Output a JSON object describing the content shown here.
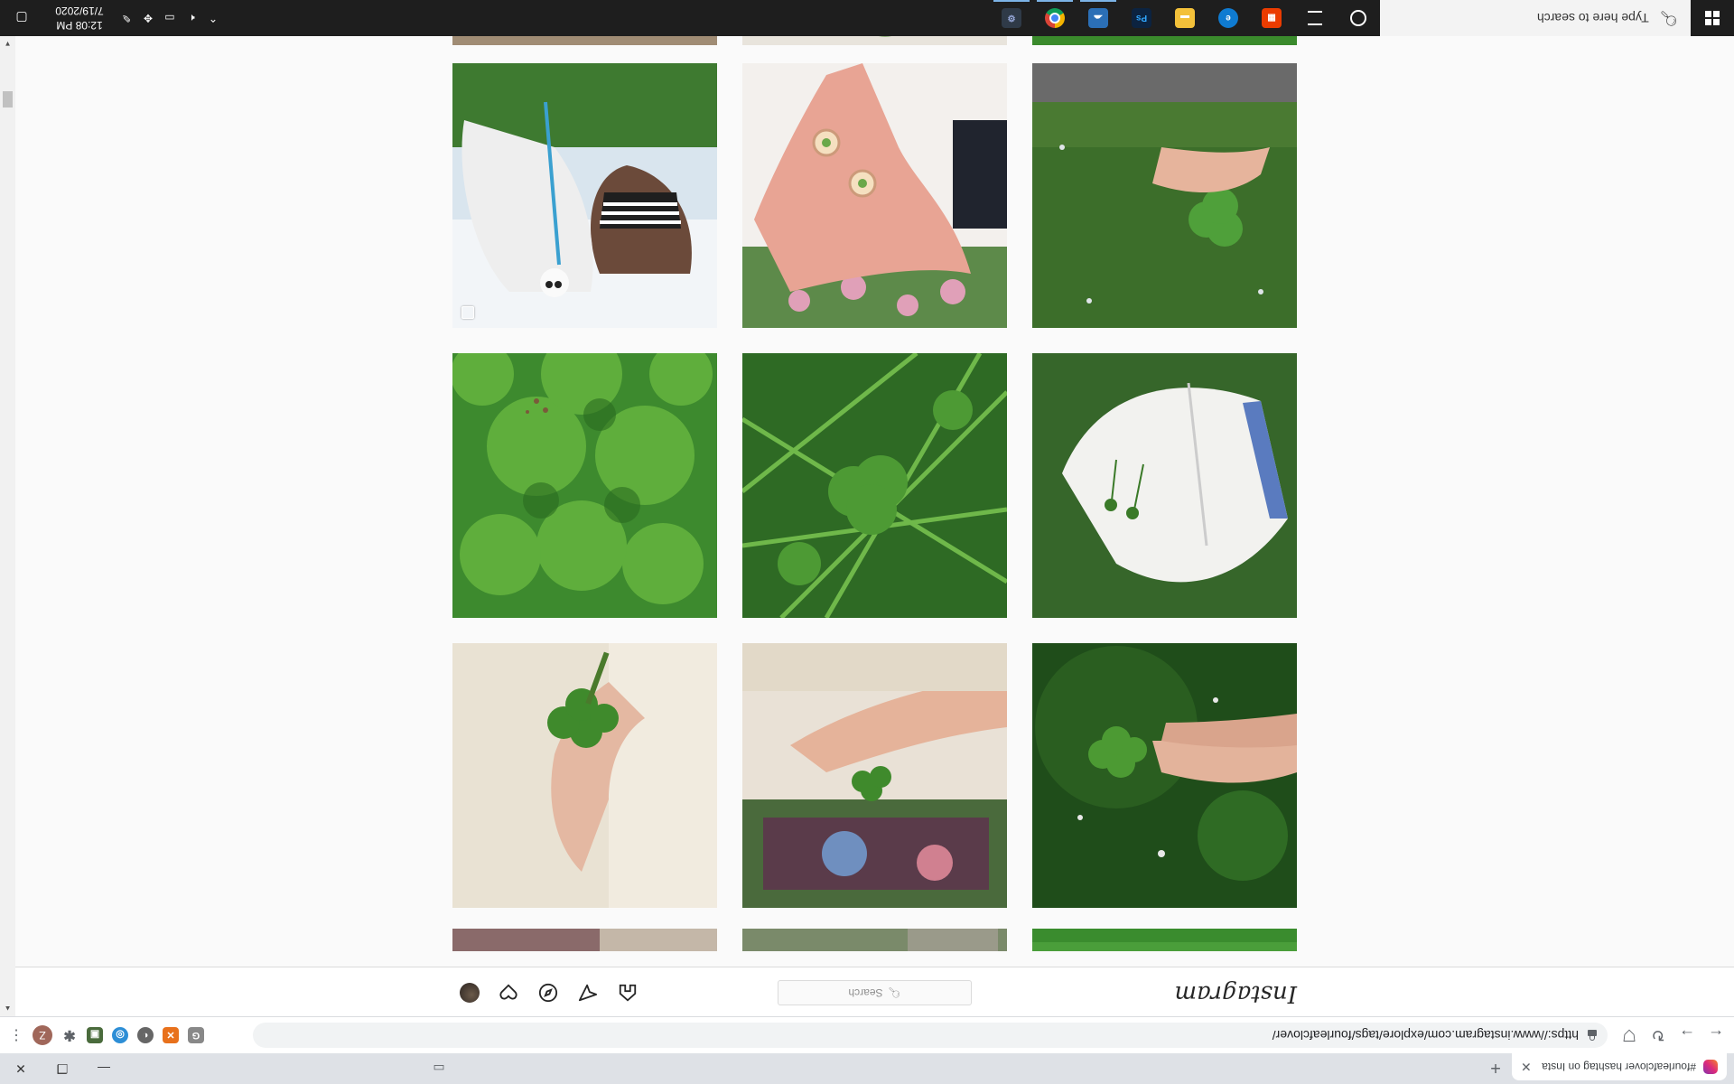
{
  "browser": {
    "tab_title": "#fourleafclover hashtag on Insta",
    "url": "https://www.instagram.com/explore/tags/fourleafclover/",
    "new_tab_symbol": "+",
    "profile_initial": "Z",
    "icons": [
      "tab-close-icon",
      "back-icon",
      "forward-icon",
      "reload-icon",
      "bookmark-icon",
      "lock-icon",
      "menu-icon"
    ]
  },
  "instagram": {
    "logo": "Instagram",
    "search_placeholder": "Search",
    "nav_icons": [
      "home-icon",
      "direct-icon",
      "explore-icon",
      "activity-icon",
      "profile-avatar"
    ]
  },
  "grid": {
    "description_colors": {
      "grass": "#3f8f2a",
      "clover": "#5fae3c"
    }
  },
  "taskbar": {
    "search_text": "Type here to search",
    "time": "12:08 PM",
    "date": "7/19/2020",
    "apps": [
      "cortana-icon",
      "task-view-icon",
      "office-icon",
      "edge-icon",
      "file-explorer-icon",
      "photoshop-icon",
      "onedrive-icon",
      "chrome-icon",
      "settings-icon"
    ]
  }
}
